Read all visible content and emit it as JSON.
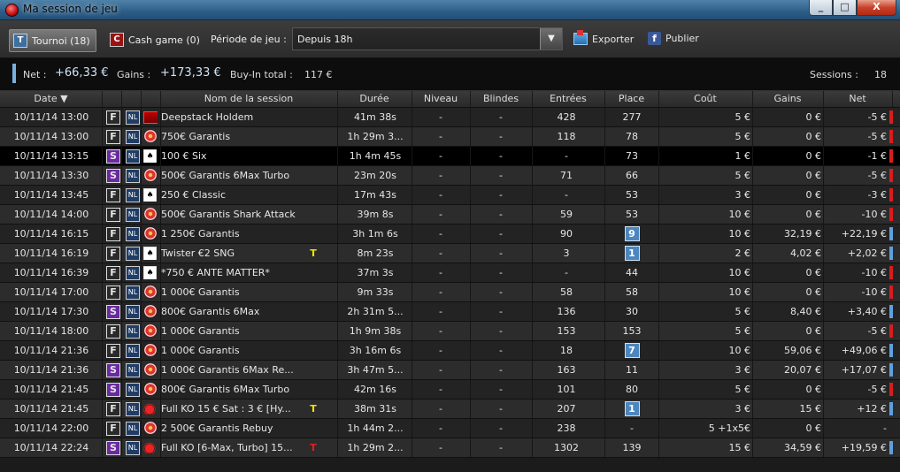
{
  "window": {
    "title": "Ma session de jeu",
    "controls": [
      "_",
      "□",
      "X"
    ]
  },
  "toolbar": {
    "tournoi_badge": "T",
    "tournoi_label": "Tournoi (18)",
    "cash_badge": "C",
    "cash_label": "Cash game (0)",
    "period_label": "Période de jeu :",
    "period_value": "Depuis 18h",
    "dropdown_arrow": "▼",
    "export_label": "Exporter",
    "publish_icon": "f",
    "publish_label": "Publier"
  },
  "summary": {
    "net_label": "Net :",
    "net_value": "+66,33 €",
    "gains_label": "Gains :",
    "gains_value": "+173,33 €",
    "buyin_label": "Buy-In total :",
    "buyin_value": "117 €",
    "sessions_label": "Sessions :",
    "sessions_value": "18"
  },
  "table": {
    "headers": [
      "Date ▼",
      "Nom de la session",
      "Durée",
      "Niveau",
      "Blindes",
      "Entrées",
      "Place",
      "Coût",
      "Gains",
      "Net"
    ],
    "rows": [
      {
        "date": "10/11/14 13:00",
        "type": "F",
        "nl": "NL",
        "site": "deep",
        "name": "Deepstack Holdem",
        "tag": "",
        "tagc": "",
        "dur": "41m 38s",
        "niv": "-",
        "bl": "-",
        "ent": "428",
        "pl": "277",
        "plbox": false,
        "cout": "5 €",
        "gains": "0 €",
        "net": "-5 €",
        "ind": "red"
      },
      {
        "date": "10/11/14 13:00",
        "type": "F",
        "nl": "NL",
        "site": "dot",
        "name": "750€ Garantis",
        "tag": "",
        "tagc": "",
        "dur": "1h 29m 3...",
        "niv": "-",
        "bl": "-",
        "ent": "118",
        "pl": "78",
        "plbox": false,
        "cout": "5 €",
        "gains": "0 €",
        "net": "-5 €",
        "ind": "red"
      },
      {
        "date": "10/11/14 13:15",
        "type": "S",
        "nl": "NL",
        "site": "box",
        "name": "100 € Six",
        "tag": "",
        "tagc": "",
        "dur": "1h 4m 45s",
        "niv": "-",
        "bl": "-",
        "ent": "-",
        "pl": "73",
        "plbox": false,
        "cout": "1 €",
        "gains": "0 €",
        "net": "-1 €",
        "ind": "red"
      },
      {
        "date": "10/11/14 13:30",
        "type": "S",
        "nl": "NL",
        "site": "dot",
        "name": "500€ Garantis 6Max Turbo",
        "tag": "",
        "tagc": "",
        "dur": "23m 20s",
        "niv": "-",
        "bl": "-",
        "ent": "71",
        "pl": "66",
        "plbox": false,
        "cout": "5 €",
        "gains": "0 €",
        "net": "-5 €",
        "ind": "red"
      },
      {
        "date": "10/11/14 13:45",
        "type": "F",
        "nl": "NL",
        "site": "box",
        "name": "250 € Classic",
        "tag": "",
        "tagc": "",
        "dur": "17m 43s",
        "niv": "-",
        "bl": "-",
        "ent": "-",
        "pl": "53",
        "plbox": false,
        "cout": "3 €",
        "gains": "0 €",
        "net": "-3 €",
        "ind": "red"
      },
      {
        "date": "10/11/14 14:00",
        "type": "F",
        "nl": "NL",
        "site": "dot",
        "name": "500€ Garantis Shark Attack",
        "tag": "",
        "tagc": "",
        "dur": "39m 8s",
        "niv": "-",
        "bl": "-",
        "ent": "59",
        "pl": "53",
        "plbox": false,
        "cout": "10 €",
        "gains": "0 €",
        "net": "-10 €",
        "ind": "red"
      },
      {
        "date": "10/11/14 16:15",
        "type": "F",
        "nl": "NL",
        "site": "dot",
        "name": "1 250€ Garantis",
        "tag": "",
        "tagc": "",
        "dur": "3h 1m 6s",
        "niv": "-",
        "bl": "-",
        "ent": "90",
        "pl": "9",
        "plbox": true,
        "cout": "10 €",
        "gains": "32,19 €",
        "net": "+22,19 €",
        "ind": "blue"
      },
      {
        "date": "10/11/14 16:19",
        "type": "F",
        "nl": "NL",
        "site": "box",
        "name": "Twister €2 SNG",
        "tag": "T",
        "tagc": "y",
        "dur": "8m 23s",
        "niv": "-",
        "bl": "-",
        "ent": "3",
        "pl": "1",
        "plbox": true,
        "cout": "2 €",
        "gains": "4,02 €",
        "net": "+2,02 €",
        "ind": "blue"
      },
      {
        "date": "10/11/14 16:39",
        "type": "F",
        "nl": "NL",
        "site": "box",
        "name": "*750 €  ANTE MATTER*",
        "tag": "",
        "tagc": "",
        "dur": "37m 3s",
        "niv": "-",
        "bl": "-",
        "ent": "-",
        "pl": "44",
        "plbox": false,
        "cout": "10 €",
        "gains": "0 €",
        "net": "-10 €",
        "ind": "red"
      },
      {
        "date": "10/11/14 17:00",
        "type": "F",
        "nl": "NL",
        "site": "dot",
        "name": "1 000€ Garantis",
        "tag": "",
        "tagc": "",
        "dur": "9m 33s",
        "niv": "-",
        "bl": "-",
        "ent": "58",
        "pl": "58",
        "plbox": false,
        "cout": "10 €",
        "gains": "0 €",
        "net": "-10 €",
        "ind": "red"
      },
      {
        "date": "10/11/14 17:30",
        "type": "S",
        "nl": "NL",
        "site": "dot",
        "name": "800€ Garantis 6Max",
        "tag": "",
        "tagc": "",
        "dur": "2h 31m 5...",
        "niv": "-",
        "bl": "-",
        "ent": "136",
        "pl": "30",
        "plbox": false,
        "cout": "5 €",
        "gains": "8,40 €",
        "net": "+3,40 €",
        "ind": "blue"
      },
      {
        "date": "10/11/14 18:00",
        "type": "F",
        "nl": "NL",
        "site": "dot",
        "name": "1 000€ Garantis",
        "tag": "",
        "tagc": "",
        "dur": "1h 9m 38s",
        "niv": "-",
        "bl": "-",
        "ent": "153",
        "pl": "153",
        "plbox": false,
        "cout": "5 €",
        "gains": "0 €",
        "net": "-5 €",
        "ind": "red"
      },
      {
        "date": "10/11/14 21:36",
        "type": "F",
        "nl": "NL",
        "site": "dot",
        "name": "1 000€ Garantis",
        "tag": "",
        "tagc": "",
        "dur": "3h 16m 6s",
        "niv": "-",
        "bl": "-",
        "ent": "18",
        "pl": "7",
        "plbox": true,
        "cout": "10 €",
        "gains": "59,06 €",
        "net": "+49,06 €",
        "ind": "blue"
      },
      {
        "date": "10/11/14 21:36",
        "type": "S",
        "nl": "NL",
        "site": "dot",
        "name": "1 000€ Garantis 6Max Re...",
        "tag": "",
        "tagc": "",
        "dur": "3h 47m 5...",
        "niv": "-",
        "bl": "-",
        "ent": "163",
        "pl": "11",
        "plbox": false,
        "cout": "3 €",
        "gains": "20,07 €",
        "net": "+17,07 €",
        "ind": "blue"
      },
      {
        "date": "10/11/14 21:45",
        "type": "S",
        "nl": "NL",
        "site": "dot",
        "name": "800€ Garantis 6Max Turbo",
        "tag": "",
        "tagc": "",
        "dur": "42m 16s",
        "niv": "-",
        "bl": "-",
        "ent": "101",
        "pl": "80",
        "plbox": false,
        "cout": "5 €",
        "gains": "0 €",
        "net": "-5 €",
        "ind": "red"
      },
      {
        "date": "10/11/14 21:45",
        "type": "F",
        "nl": "NL",
        "site": "ko",
        "name": "Full KO 15 € Sat : 3 €  [Hy...",
        "tag": "T",
        "tagc": "y",
        "dur": "38m 31s",
        "niv": "-",
        "bl": "-",
        "ent": "207",
        "pl": "1",
        "plbox": true,
        "cout": "3 €",
        "gains": "15 €",
        "net": "+12 €",
        "ind": "blue"
      },
      {
        "date": "10/11/14 22:00",
        "type": "F",
        "nl": "NL",
        "site": "dot",
        "name": "2 500€ Garantis Rebuy",
        "tag": "",
        "tagc": "",
        "dur": "1h 44m 2...",
        "niv": "-",
        "bl": "-",
        "ent": "238",
        "pl": "-",
        "plbox": false,
        "cout": "5  +1x5€",
        "gains": "0 €",
        "net": "-",
        "ind": ""
      },
      {
        "date": "10/11/14 22:24",
        "type": "S",
        "nl": "NL",
        "site": "ko",
        "name": "Full KO [6-Max, Turbo] 15...",
        "tag": "T",
        "tagc": "r",
        "dur": "1h 29m 2...",
        "niv": "-",
        "bl": "-",
        "ent": "1302",
        "pl": "139",
        "plbox": false,
        "cout": "15 €",
        "gains": "34,59 €",
        "net": "+19,59 €",
        "ind": "blue"
      }
    ]
  }
}
